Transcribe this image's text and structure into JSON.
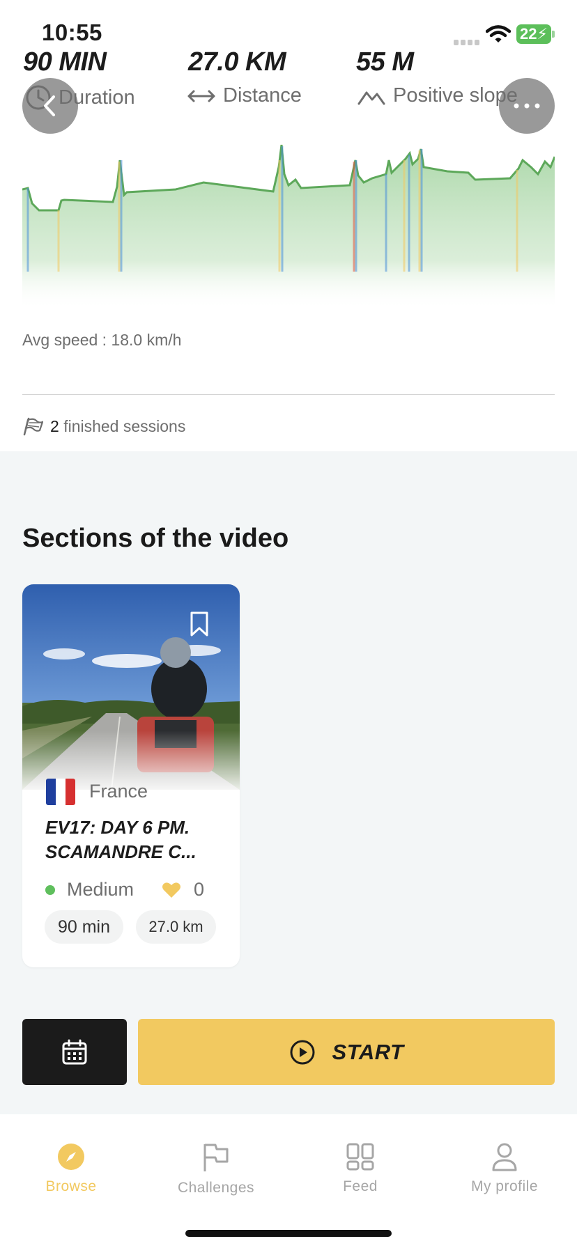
{
  "status_bar": {
    "time": "10:55",
    "battery": "22"
  },
  "stats": [
    {
      "value": "90 MIN",
      "label": "Duration",
      "icon": "clock-icon"
    },
    {
      "value": "27.0 KM",
      "label": "Distance",
      "icon": "distance-arrows-icon"
    },
    {
      "value": "55 M",
      "label": "Positive slope",
      "icon": "mountain-icon"
    }
  ],
  "elevation_profile": {
    "type": "area",
    "colors": {
      "flat": "#5da85a",
      "moderate": "#f2c960",
      "steep": "#4a90d9",
      "very_steep": "#e0533f"
    }
  },
  "avg_speed": "Avg speed : 18.0 km/h",
  "sessions": {
    "count": "2",
    "label": "finished sessions"
  },
  "sections": {
    "title": "Sections of the video",
    "cards": [
      {
        "country": "France",
        "title": "EV17: DAY 6 PM.\nSCAMANDRE C...",
        "difficulty": "Medium",
        "likes": "0",
        "duration": "90 min",
        "distance": "27.0 km",
        "bookmarked": false
      }
    ]
  },
  "actions": {
    "start_label": "START",
    "calendar_icon": "calendar-icon",
    "start_icon": "play-circle-icon"
  },
  "tabs": [
    {
      "label": "Browse",
      "icon": "compass-icon",
      "active": true
    },
    {
      "label": "Challenges",
      "icon": "flag-icon",
      "active": false
    },
    {
      "label": "Feed",
      "icon": "grid-icon",
      "active": false
    },
    {
      "label": "My profile",
      "icon": "person-icon",
      "active": false
    }
  ],
  "colors": {
    "accent": "#f2c960",
    "dark": "#1b1b1b",
    "muted": "#6e6e6e",
    "green": "#5fbf5d"
  }
}
